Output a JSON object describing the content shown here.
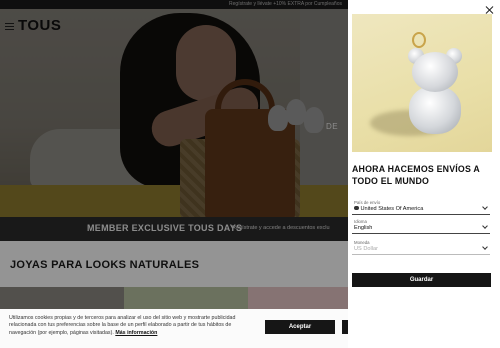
{
  "topbar": {
    "promo": "Regístrate y llévate +10% EXTRA por Cumpleaños"
  },
  "header": {
    "logo": "TOUS"
  },
  "hero": {
    "side_text": "DE"
  },
  "member_bar": {
    "title": "MEMBER EXCLUSIVE TOUS DAYS",
    "subtitle": "Regístrate y accede a descuentos exclu"
  },
  "section": {
    "title": "JOYAS PARA LOOKS NATURALES"
  },
  "cookie": {
    "text": "Utilizamos cookies propias y de terceros para analizar el uso del sitio web y mostrarte publicidad relacionada con tus preferencias sobre la base de un perfil elaborado a partir de tus hábitos de navegación (por ejemplo, páginas visitadas).",
    "link": "Más información",
    "accept": "Aceptar"
  },
  "modal": {
    "title": "AHORA HACEMOS ENVÍOS A TODO EL MUNDO",
    "fields": [
      {
        "label": "País de envío",
        "value": "United States Of America",
        "icon": "flag-icon"
      },
      {
        "label": "Idioma",
        "value": "English"
      },
      {
        "label": "Moneda",
        "value": "US Dollar"
      }
    ],
    "save": "Guardar"
  },
  "colors": {
    "dark": "#151515",
    "overlay": "rgba(0,0,0,0.42)",
    "member_bar": "#2c2c2c"
  }
}
